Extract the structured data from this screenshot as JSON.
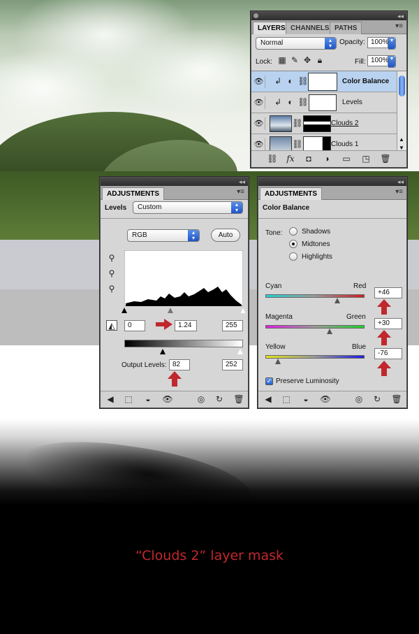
{
  "caption": "“Clouds 2” layer mask",
  "layers_panel": {
    "tabs": [
      "LAYERS",
      "CHANNELS",
      "PATHS"
    ],
    "blend_mode": "Normal",
    "opacity_label": "Opacity:",
    "opacity_value": "100%",
    "lock_label": "Lock:",
    "fill_label": "Fill:",
    "fill_value": "100%",
    "layers": [
      {
        "name": "Color Balance",
        "selected": true
      },
      {
        "name": "Levels",
        "selected": false
      },
      {
        "name": "Clouds 2",
        "selected": false
      },
      {
        "name": "Clouds 1",
        "selected": false
      }
    ]
  },
  "levels_panel": {
    "tab": "ADJUSTMENTS",
    "title": "Levels",
    "preset": "Custom",
    "channel": "RGB",
    "auto_button": "Auto",
    "input_black": "0",
    "input_gamma": "1.24",
    "input_white": "255",
    "output_label": "Output Levels:",
    "output_black": "82",
    "output_white": "252",
    "input_gamma_fraction": 0.39
  },
  "color_balance_panel": {
    "tab": "ADJUSTMENTS",
    "title": "Color Balance",
    "tone_label": "Tone:",
    "tones": [
      {
        "label": "Shadows",
        "selected": false
      },
      {
        "label": "Midtones",
        "selected": true
      },
      {
        "label": "Highlights",
        "selected": false
      }
    ],
    "sliders": [
      {
        "left": "Cyan",
        "right": "Red",
        "value": "+46",
        "number": 46,
        "colors": [
          "#21d2d4",
          "#d21d21"
        ]
      },
      {
        "left": "Magenta",
        "right": "Green",
        "value": "+30",
        "number": 30,
        "colors": [
          "#e21de2",
          "#21d22a"
        ]
      },
      {
        "left": "Yellow",
        "right": "Blue",
        "value": "-76",
        "number": -76,
        "colors": [
          "#e6e61c",
          "#1c1ce6"
        ]
      }
    ],
    "preserve_luminosity": "Preserve Luminosity",
    "preserve_checked": true
  },
  "colors": {
    "accent_red": "#c0282e",
    "selection_blue": "#b9d2f0"
  }
}
